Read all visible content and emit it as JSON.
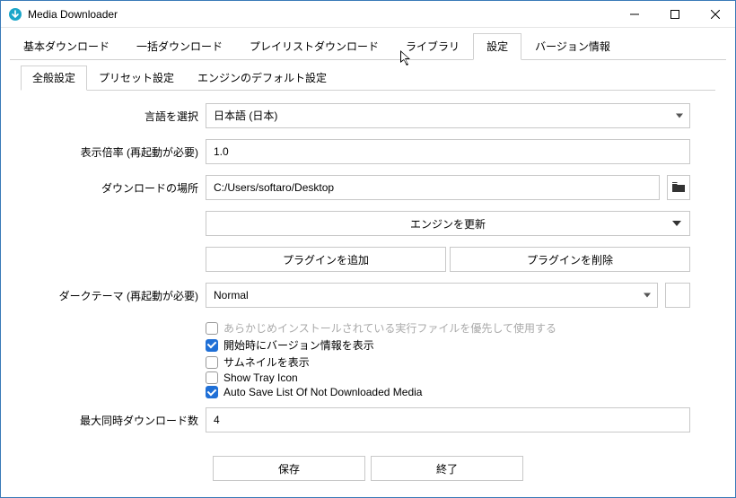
{
  "window": {
    "title": "Media Downloader"
  },
  "tabs": {
    "main": [
      "基本ダウンロード",
      "一括ダウンロード",
      "プレイリストダウンロード",
      "ライブラリ",
      "設定",
      "バージョン情報"
    ],
    "main_active": 4,
    "sub": [
      "全般設定",
      "プリセット設定",
      "エンジンのデフォルト設定"
    ],
    "sub_active": 0
  },
  "labels": {
    "language": "言語を選択",
    "scale": "表示倍率 (再起動が必要)",
    "download_loc": "ダウンロードの場所",
    "update_engine": "エンジンを更新",
    "add_plugin": "プラグインを追加",
    "remove_plugin": "プラグインを削除",
    "dark_theme": "ダークテーマ (再起動が必要)",
    "max_concurrent": "最大同時ダウンロード数",
    "save": "保存",
    "exit": "終了"
  },
  "values": {
    "language": "日本語 (日本)",
    "scale": "1.0",
    "download_loc": "C:/Users/softaro/Desktop",
    "dark_theme": "Normal",
    "max_concurrent": "4"
  },
  "checkboxes": [
    {
      "label": "あらかじめインストールされている実行ファイルを優先して使用する",
      "checked": false,
      "muted": true
    },
    {
      "label": "開始時にバージョン情報を表示",
      "checked": true,
      "muted": false
    },
    {
      "label": "サムネイルを表示",
      "checked": false,
      "muted": false
    },
    {
      "label": "Show Tray Icon",
      "checked": false,
      "muted": false
    },
    {
      "label": "Auto Save List Of Not Downloaded Media",
      "checked": true,
      "muted": false
    }
  ],
  "icons": {
    "folder": "folder-icon",
    "app": "app-icon"
  }
}
